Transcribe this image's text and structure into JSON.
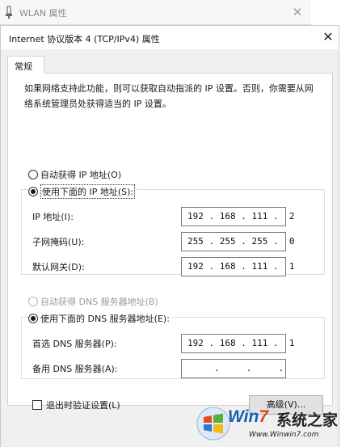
{
  "bg_window": {
    "title": "WLAN 属性",
    "close_glyph": "✕"
  },
  "dialog": {
    "title": "Internet 协议版本 4 (TCP/IPv4) 属性",
    "close_glyph": "✕"
  },
  "tabs": [
    {
      "label": "常规"
    }
  ],
  "description": "如果网络支持此功能，则可以获取自动指派的 IP 设置。否则，你需要从网络系统管理员处获得适当的 IP 设置。",
  "ip_section": {
    "auto_label": "自动获得 IP 地址(O)",
    "auto_selected": false,
    "manual_label": "使用下面的 IP 地址(S):",
    "manual_selected": true,
    "fields": [
      {
        "label": "IP 地址(I):",
        "value": "192 . 168 . 111 .  2"
      },
      {
        "label": "子网掩码(U):",
        "value": "255 . 255 . 255 .  0"
      },
      {
        "label": "默认网关(D):",
        "value": "192 . 168 . 111 .  1"
      }
    ]
  },
  "dns_section": {
    "auto_label": "自动获得 DNS 服务器地址(B)",
    "auto_enabled": false,
    "manual_label": "使用下面的 DNS 服务器地址(E):",
    "manual_selected": true,
    "fields": [
      {
        "label": "首选 DNS 服务器(P):",
        "value": "192 . 168 . 111 .  1"
      },
      {
        "label": "备用 DNS 服务器(A):",
        "value": "     .     .     ."
      }
    ]
  },
  "validate_on_exit": {
    "label": "退出时验证设置(L)",
    "checked": false
  },
  "advanced_button": "高级(V)...",
  "watermark": {
    "brand_win": "Win",
    "brand_seven": "7",
    "brand_cn": "系统之家",
    "url": "Www.Winwin7.com"
  },
  "colors": {
    "accent": "#1a5fb4",
    "panel_bg": "#ffffff",
    "client_bg": "#f0f0f0"
  }
}
